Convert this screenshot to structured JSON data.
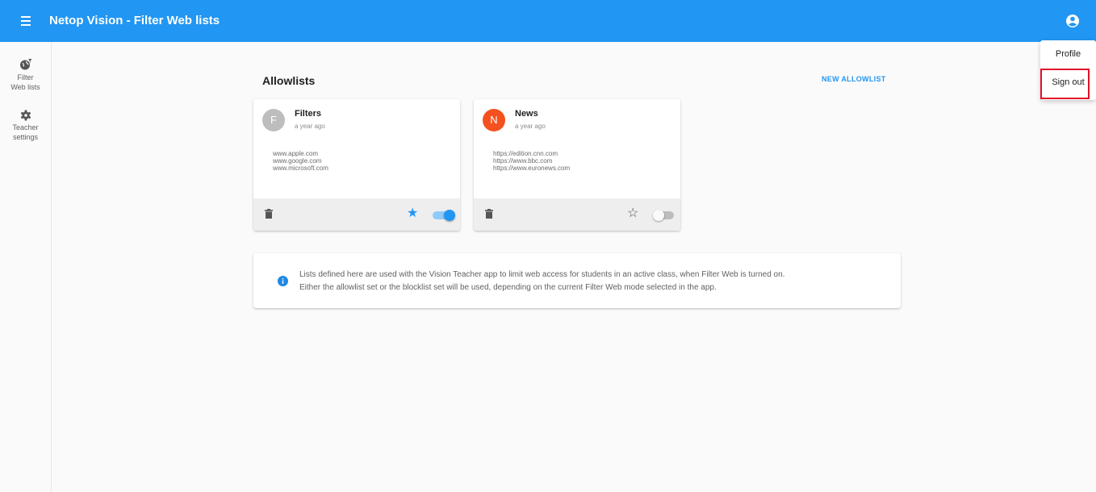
{
  "appbar": {
    "title": "Netop Vision - Filter Web lists",
    "menu_icon": "hamburger-icon",
    "account_icon": "account-circle-icon",
    "color": "#2196f3"
  },
  "sidebar": {
    "items": [
      {
        "label": "Filter Web lists",
        "icon": "globe-filter-icon"
      },
      {
        "label": "Teacher settings",
        "icon": "gear-icon"
      }
    ]
  },
  "main": {
    "section_title": "Allowlists",
    "new_button_label": "NEW ALLOWLIST",
    "cards": [
      {
        "avatar_letter": "F",
        "avatar_color": "#bdbdbd",
        "title": "Filters",
        "subtitle": "a year ago",
        "urls": [
          "www.apple.com",
          "www.google.com",
          "www.microsoft.com"
        ],
        "starred": true,
        "star_glyph": "★",
        "enabled": true
      },
      {
        "avatar_letter": "N",
        "avatar_color": "#f4511e",
        "title": "News",
        "subtitle": "a year ago",
        "urls": [
          "https://edition.cnn.com",
          "https://www.bbc.com",
          "https://www.euronews.com"
        ],
        "starred": false,
        "star_glyph": "☆",
        "enabled": false
      }
    ],
    "info": {
      "line1": "Lists defined here are used with the Vision Teacher app to limit web access for students in an active class, when Filter Web is turned on.",
      "line2": "Either the allowlist set or the blocklist set will be used, depending on the current Filter Web mode selected in the app."
    }
  },
  "account_menu": {
    "items": [
      "Profile",
      "Sign out"
    ],
    "highlight_color": "#e0102a"
  }
}
